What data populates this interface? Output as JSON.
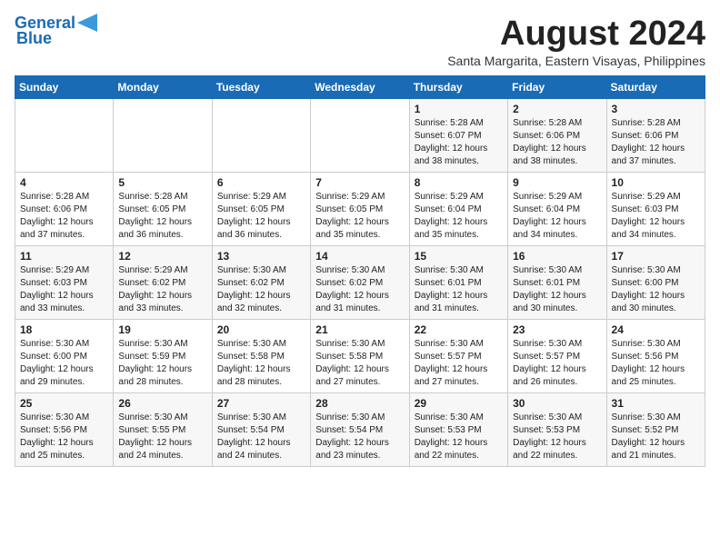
{
  "logo": {
    "line1": "General",
    "line2": "Blue"
  },
  "title": "August 2024",
  "location": "Santa Margarita, Eastern Visayas, Philippines",
  "days": [
    "Sunday",
    "Monday",
    "Tuesday",
    "Wednesday",
    "Thursday",
    "Friday",
    "Saturday"
  ],
  "weeks": [
    [
      {
        "date": "",
        "text": ""
      },
      {
        "date": "",
        "text": ""
      },
      {
        "date": "",
        "text": ""
      },
      {
        "date": "",
        "text": ""
      },
      {
        "date": "1",
        "text": "Sunrise: 5:28 AM\nSunset: 6:07 PM\nDaylight: 12 hours\nand 38 minutes."
      },
      {
        "date": "2",
        "text": "Sunrise: 5:28 AM\nSunset: 6:06 PM\nDaylight: 12 hours\nand 38 minutes."
      },
      {
        "date": "3",
        "text": "Sunrise: 5:28 AM\nSunset: 6:06 PM\nDaylight: 12 hours\nand 37 minutes."
      }
    ],
    [
      {
        "date": "4",
        "text": "Sunrise: 5:28 AM\nSunset: 6:06 PM\nDaylight: 12 hours\nand 37 minutes."
      },
      {
        "date": "5",
        "text": "Sunrise: 5:28 AM\nSunset: 6:05 PM\nDaylight: 12 hours\nand 36 minutes."
      },
      {
        "date": "6",
        "text": "Sunrise: 5:29 AM\nSunset: 6:05 PM\nDaylight: 12 hours\nand 36 minutes."
      },
      {
        "date": "7",
        "text": "Sunrise: 5:29 AM\nSunset: 6:05 PM\nDaylight: 12 hours\nand 35 minutes."
      },
      {
        "date": "8",
        "text": "Sunrise: 5:29 AM\nSunset: 6:04 PM\nDaylight: 12 hours\nand 35 minutes."
      },
      {
        "date": "9",
        "text": "Sunrise: 5:29 AM\nSunset: 6:04 PM\nDaylight: 12 hours\nand 34 minutes."
      },
      {
        "date": "10",
        "text": "Sunrise: 5:29 AM\nSunset: 6:03 PM\nDaylight: 12 hours\nand 34 minutes."
      }
    ],
    [
      {
        "date": "11",
        "text": "Sunrise: 5:29 AM\nSunset: 6:03 PM\nDaylight: 12 hours\nand 33 minutes."
      },
      {
        "date": "12",
        "text": "Sunrise: 5:29 AM\nSunset: 6:02 PM\nDaylight: 12 hours\nand 33 minutes."
      },
      {
        "date": "13",
        "text": "Sunrise: 5:30 AM\nSunset: 6:02 PM\nDaylight: 12 hours\nand 32 minutes."
      },
      {
        "date": "14",
        "text": "Sunrise: 5:30 AM\nSunset: 6:02 PM\nDaylight: 12 hours\nand 31 minutes."
      },
      {
        "date": "15",
        "text": "Sunrise: 5:30 AM\nSunset: 6:01 PM\nDaylight: 12 hours\nand 31 minutes."
      },
      {
        "date": "16",
        "text": "Sunrise: 5:30 AM\nSunset: 6:01 PM\nDaylight: 12 hours\nand 30 minutes."
      },
      {
        "date": "17",
        "text": "Sunrise: 5:30 AM\nSunset: 6:00 PM\nDaylight: 12 hours\nand 30 minutes."
      }
    ],
    [
      {
        "date": "18",
        "text": "Sunrise: 5:30 AM\nSunset: 6:00 PM\nDaylight: 12 hours\nand 29 minutes."
      },
      {
        "date": "19",
        "text": "Sunrise: 5:30 AM\nSunset: 5:59 PM\nDaylight: 12 hours\nand 28 minutes."
      },
      {
        "date": "20",
        "text": "Sunrise: 5:30 AM\nSunset: 5:58 PM\nDaylight: 12 hours\nand 28 minutes."
      },
      {
        "date": "21",
        "text": "Sunrise: 5:30 AM\nSunset: 5:58 PM\nDaylight: 12 hours\nand 27 minutes."
      },
      {
        "date": "22",
        "text": "Sunrise: 5:30 AM\nSunset: 5:57 PM\nDaylight: 12 hours\nand 27 minutes."
      },
      {
        "date": "23",
        "text": "Sunrise: 5:30 AM\nSunset: 5:57 PM\nDaylight: 12 hours\nand 26 minutes."
      },
      {
        "date": "24",
        "text": "Sunrise: 5:30 AM\nSunset: 5:56 PM\nDaylight: 12 hours\nand 25 minutes."
      }
    ],
    [
      {
        "date": "25",
        "text": "Sunrise: 5:30 AM\nSunset: 5:56 PM\nDaylight: 12 hours\nand 25 minutes."
      },
      {
        "date": "26",
        "text": "Sunrise: 5:30 AM\nSunset: 5:55 PM\nDaylight: 12 hours\nand 24 minutes."
      },
      {
        "date": "27",
        "text": "Sunrise: 5:30 AM\nSunset: 5:54 PM\nDaylight: 12 hours\nand 24 minutes."
      },
      {
        "date": "28",
        "text": "Sunrise: 5:30 AM\nSunset: 5:54 PM\nDaylight: 12 hours\nand 23 minutes."
      },
      {
        "date": "29",
        "text": "Sunrise: 5:30 AM\nSunset: 5:53 PM\nDaylight: 12 hours\nand 22 minutes."
      },
      {
        "date": "30",
        "text": "Sunrise: 5:30 AM\nSunset: 5:53 PM\nDaylight: 12 hours\nand 22 minutes."
      },
      {
        "date": "31",
        "text": "Sunrise: 5:30 AM\nSunset: 5:52 PM\nDaylight: 12 hours\nand 21 minutes."
      }
    ]
  ]
}
